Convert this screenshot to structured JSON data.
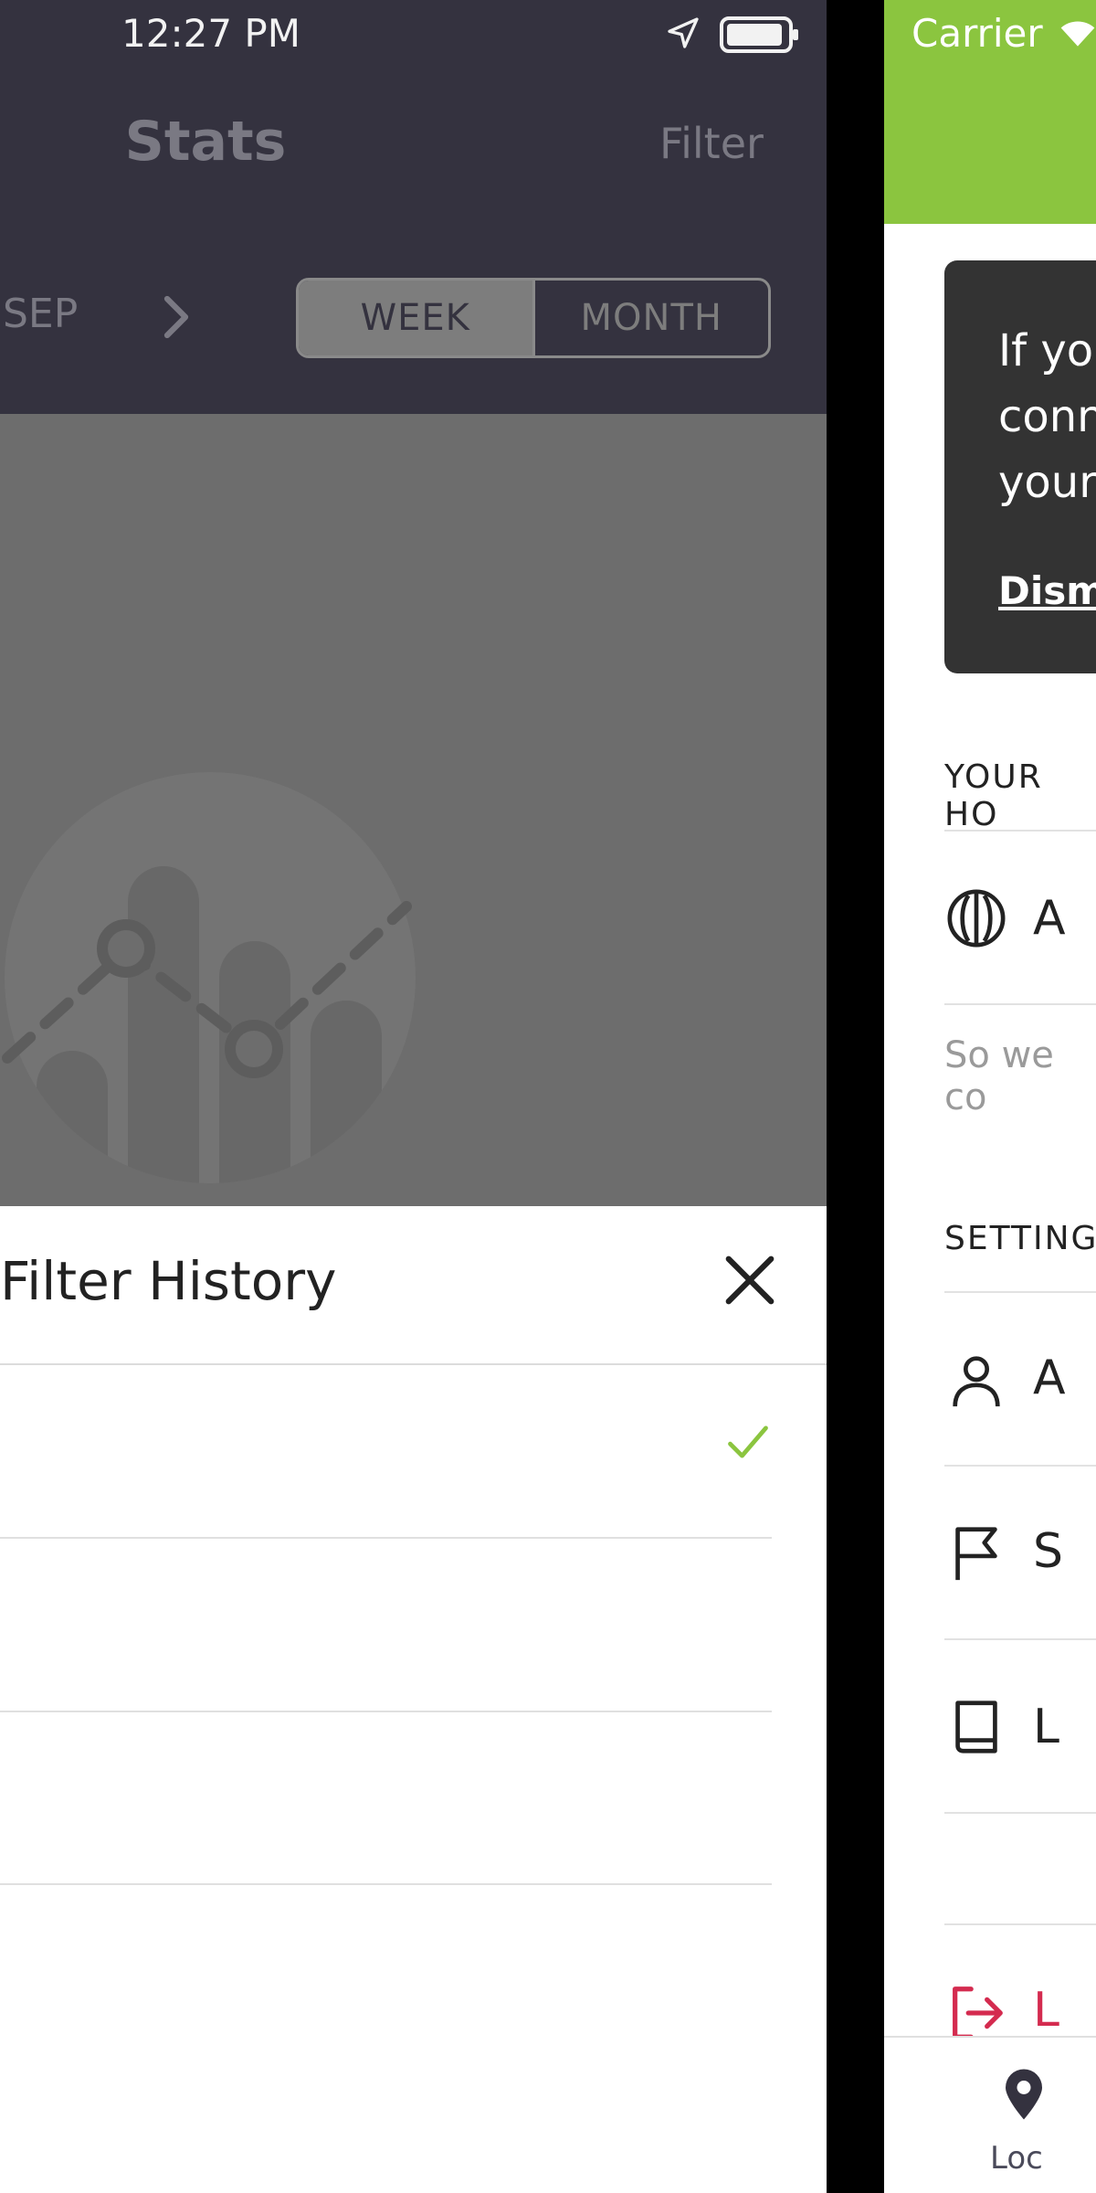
{
  "left": {
    "status": {
      "time": "12:27 PM"
    },
    "header": {
      "title": "Stats",
      "filter_label": "Filter"
    },
    "period": {
      "label": "SEP",
      "segments": [
        {
          "label": "WEEK",
          "selected": true
        },
        {
          "label": "MONTH",
          "selected": false
        }
      ]
    },
    "sheet": {
      "title": "Filter History",
      "options": [
        {
          "label": "",
          "checked": true
        },
        {
          "label": "",
          "checked": false
        },
        {
          "label": "",
          "checked": false
        }
      ]
    },
    "colors": {
      "header_bg": "#34323f",
      "dim_overlay": "#6d6d6d",
      "check": "#8bc53f"
    }
  },
  "right": {
    "status": {
      "carrier": "Carrier"
    },
    "notice": {
      "text": "If yo\nconn\nyour",
      "dismiss_label": "Dism"
    },
    "sections": [
      {
        "title": "YOUR HO",
        "rows": [
          {
            "icon": "coin-icon",
            "label": "A"
          }
        ],
        "hint": "So we co"
      },
      {
        "title": "SETTING",
        "rows": [
          {
            "icon": "person-icon",
            "label": "A"
          },
          {
            "icon": "flag-icon",
            "label": "S"
          },
          {
            "icon": "book-icon",
            "label": "L"
          }
        ]
      }
    ],
    "logout": {
      "label": "L"
    },
    "tabbar": {
      "active_label": "Loc"
    },
    "colors": {
      "header_bg": "#8bc53f",
      "card_bg": "#333333",
      "logout": "#d42b4f"
    }
  }
}
